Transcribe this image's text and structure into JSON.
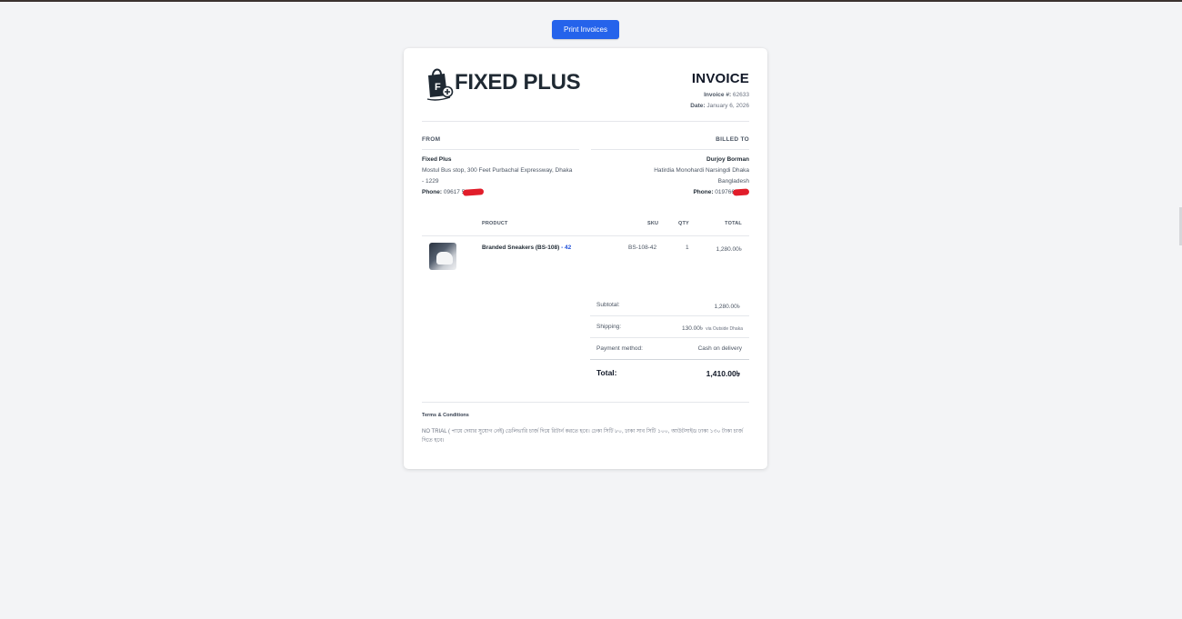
{
  "toolbar": {
    "print_label": "Print Invoices"
  },
  "brand": {
    "name": "FIXED PLUS",
    "accent": "#2563eb"
  },
  "invoice": {
    "title": "INVOICE",
    "number_label": "Invoice #:",
    "number": "62633",
    "date_label": "Date:",
    "date": "January 6, 2026"
  },
  "from": {
    "label": "FROM",
    "name": "Fixed Plus",
    "address_line1": "Mostul Bus stop, 300 Feet Purbachal Expressway, Dhaka",
    "address_line2": "- 1229",
    "phone_label": "Phone:",
    "phone": "09617 5"
  },
  "billed_to": {
    "label": "BILLED TO",
    "name": "Durjoy Borman",
    "address_line1": "Hatirdia Monohardi Narsingdi Dhaka",
    "address_line2": "Bangladesh",
    "phone_label": "Phone:",
    "phone": "019766"
  },
  "table": {
    "headers": {
      "product": "PRODUCT",
      "sku": "SKU",
      "qty": "QTY",
      "total": "TOTAL"
    },
    "rows": [
      {
        "name": "Branded Sneakers (BS-108)",
        "variant": " - 42",
        "sku": "BS-108-42",
        "qty": "1",
        "total": "1,280.00৳"
      }
    ]
  },
  "totals": {
    "subtotal_label": "Subtotal:",
    "subtotal": "1,280.00৳",
    "shipping_label": "Shipping:",
    "shipping": "130.00৳",
    "shipping_via": "via Outside Dhaka",
    "payment_label": "Payment method:",
    "payment": "Cash on delivery",
    "total_label": "Total:",
    "total": "1,410.00৳"
  },
  "terms": {
    "title": "Terms & Conditions",
    "text": "NO TRIAL ( পায়ে দেয়ার সুযোগ নেই) ডেলিভারি চার্জ দিয়ে রিটার্ন করতে হবে। ঢেকা সিটি ৮০, ঢাকা সাব সিটি ১০০, আউটসাইড ঢাকা ১৩০ টাকা চার্জ দিতে হবে।"
  }
}
